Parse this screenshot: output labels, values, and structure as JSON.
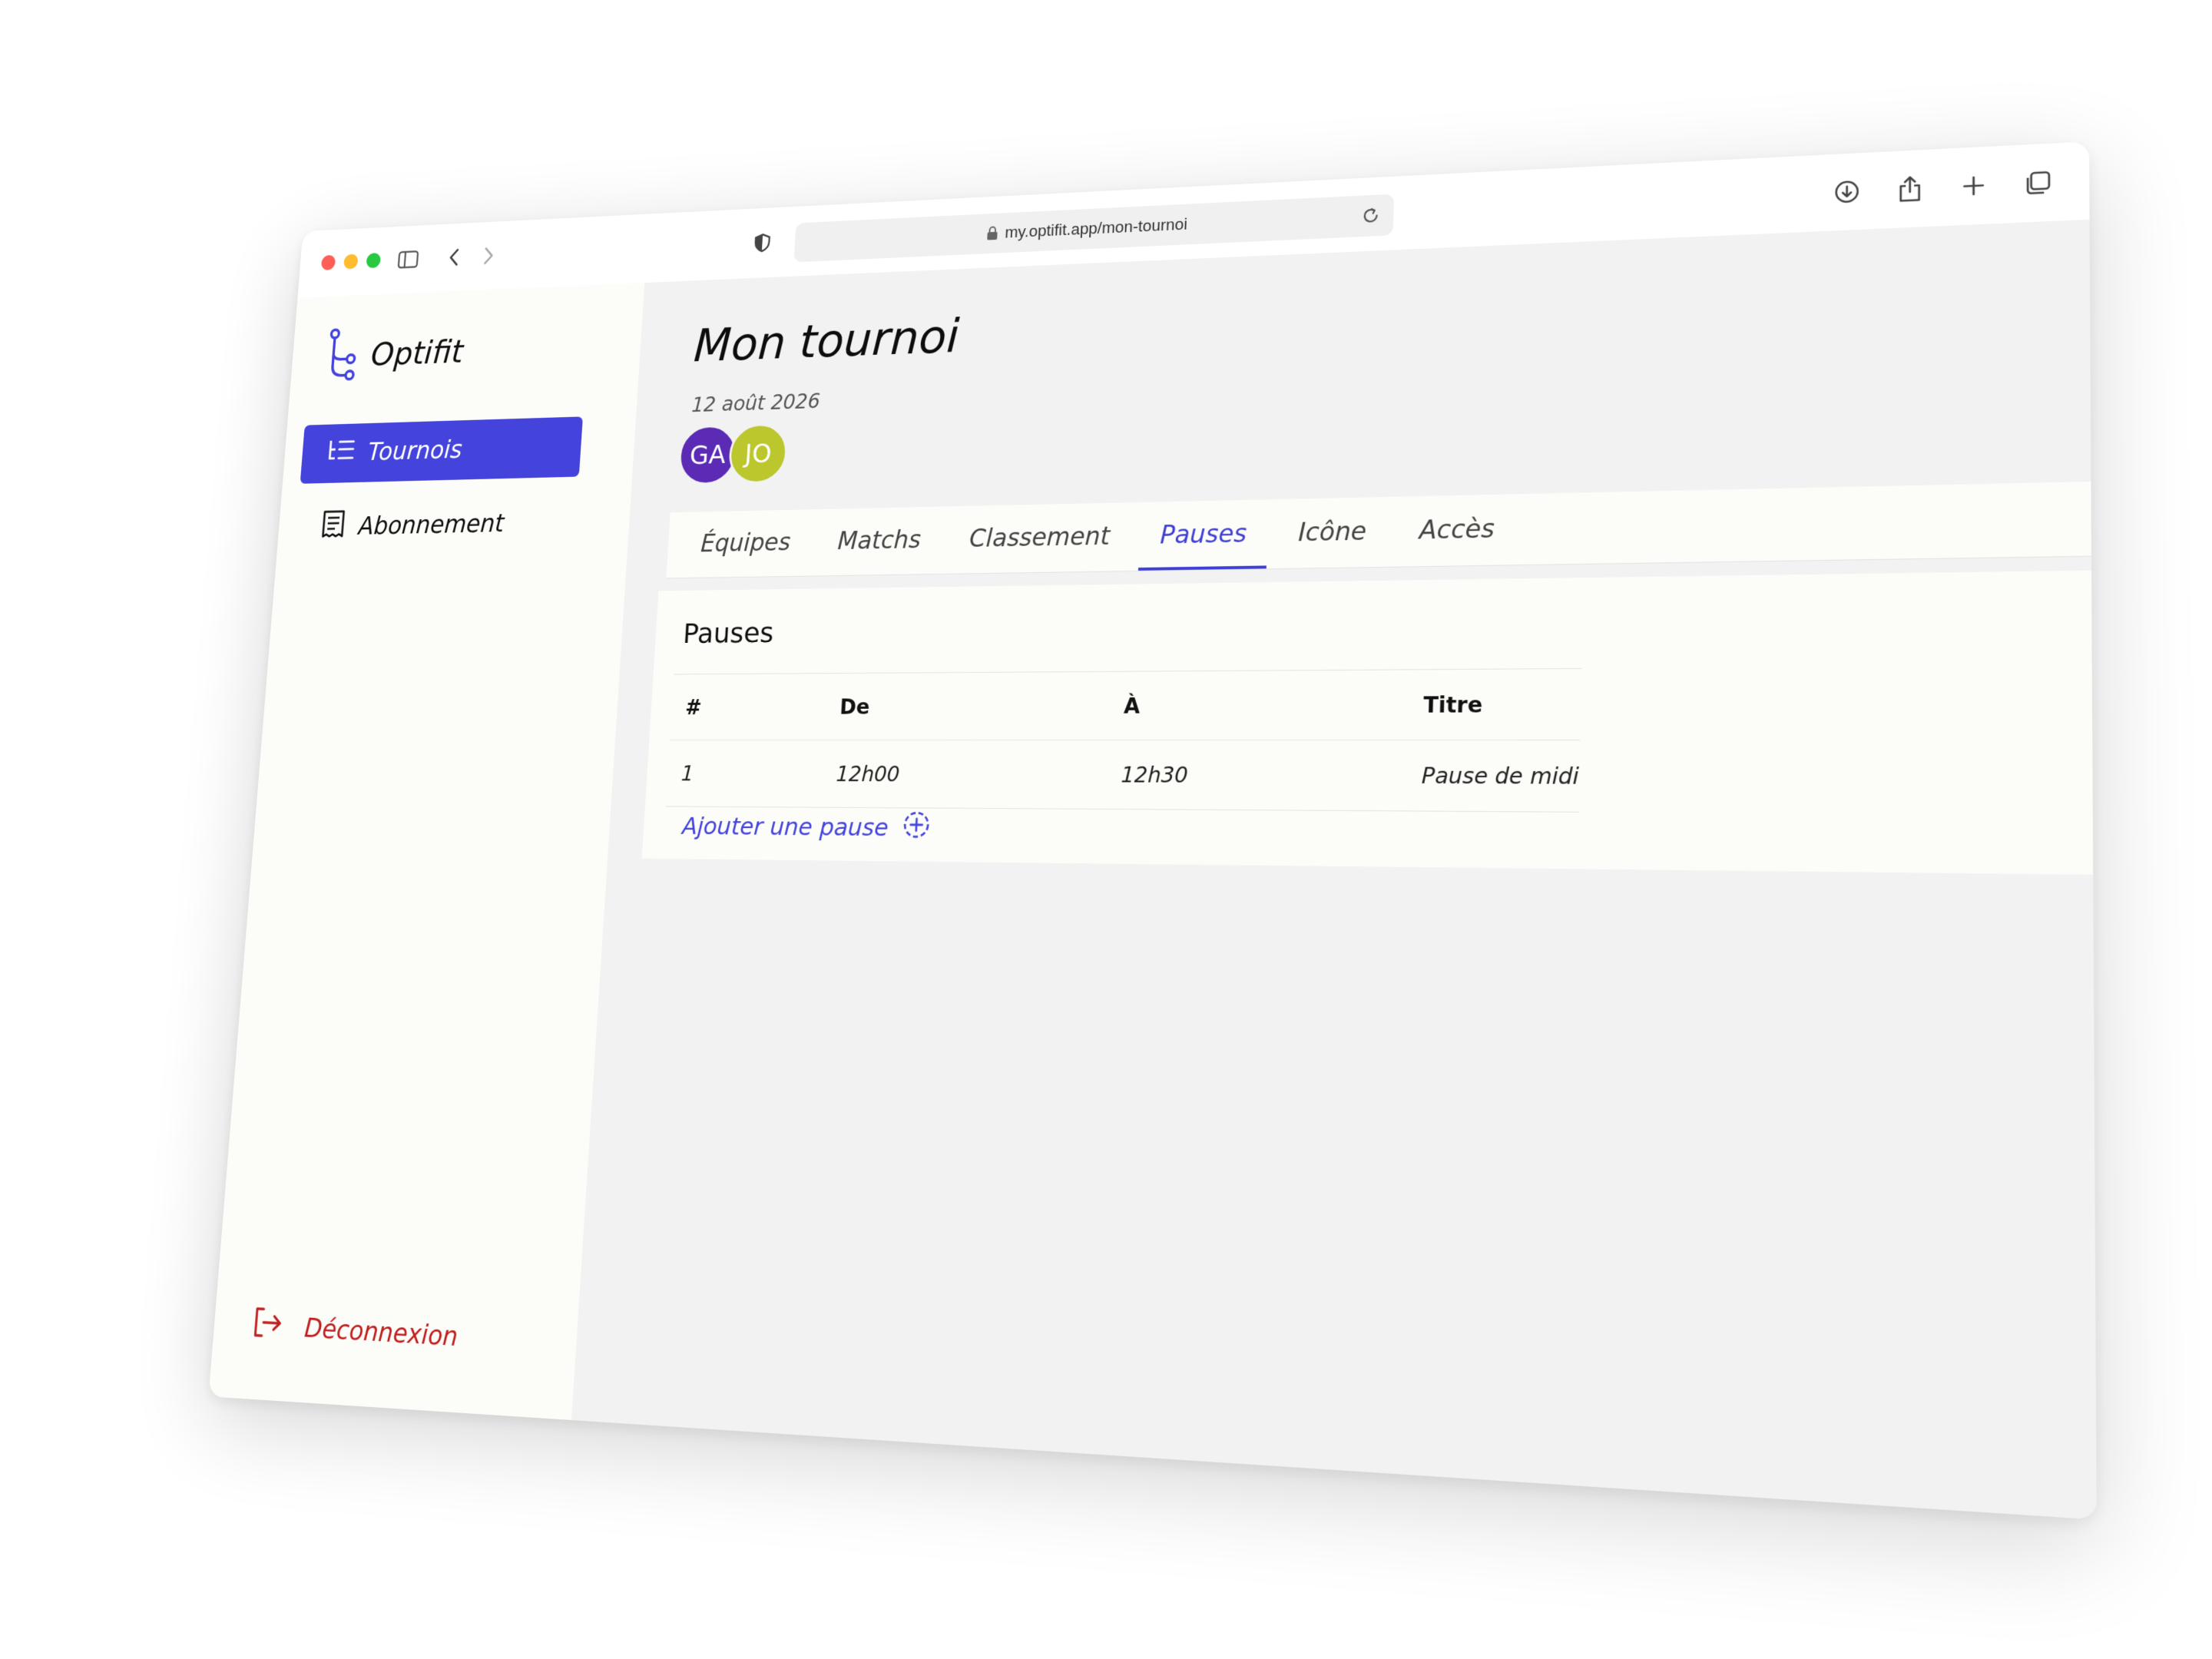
{
  "browser": {
    "url": "my.optifit.app/mon-tournoi"
  },
  "sidebar": {
    "brand": "Optifit",
    "items": [
      {
        "label": "Tournois",
        "icon": "list-tree-icon",
        "active": true
      },
      {
        "label": "Abonnement",
        "icon": "receipt-icon",
        "active": false
      }
    ],
    "logout_label": "Déconnexion"
  },
  "page": {
    "title": "Mon tournoi",
    "date": "12 août 2026",
    "avatars": [
      {
        "initials": "GA",
        "color": "#5b2bb5"
      },
      {
        "initials": "JO",
        "color": "#bcc62d"
      }
    ]
  },
  "tabs": [
    {
      "label": "Équipes",
      "active": false
    },
    {
      "label": "Matchs",
      "active": false
    },
    {
      "label": "Classement",
      "active": false
    },
    {
      "label": "Pauses",
      "active": true
    },
    {
      "label": "Icône",
      "active": false
    },
    {
      "label": "Accès",
      "active": false
    }
  ],
  "pauses": {
    "title": "Pauses",
    "columns": [
      "#",
      "De",
      "À",
      "Titre"
    ],
    "rows": [
      {
        "num": "1",
        "from": "12h00",
        "to": "12h30",
        "title": "Pause de midi"
      }
    ],
    "add_label": "Ajouter une pause"
  },
  "colors": {
    "accent": "#4444dd",
    "danger": "#c02020"
  }
}
